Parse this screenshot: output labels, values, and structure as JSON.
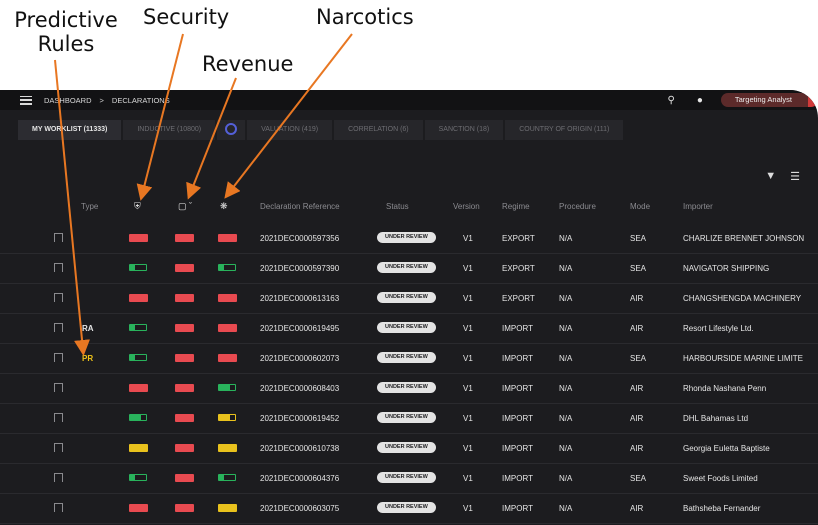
{
  "annotations": {
    "predictive_rules": "Predictive\nRules",
    "security": "Security",
    "revenue": "Revenue",
    "narcotics": "Narcotics"
  },
  "topbar": {
    "dashboard": "DASHBOARD",
    "separator": ">",
    "declarations": "DECLARATIONS",
    "role": "Targeting Analyst",
    "icons": [
      "search-icon",
      "bell-icon",
      "menu-icon"
    ]
  },
  "tabs": [
    {
      "label": "MY WORKLIST (11333)",
      "active": true
    },
    {
      "label": "INDUCTIVE (10800)",
      "active": false
    },
    {
      "label": "",
      "icon": "circle-icon",
      "active": false
    },
    {
      "label": "VALUATION (419)",
      "active": false
    },
    {
      "label": "CORRELATION (6)",
      "active": false
    },
    {
      "label": "SANCTION (18)",
      "active": false
    },
    {
      "label": "COUNTRY OF ORIGIN (111)",
      "active": false
    }
  ],
  "columns": {
    "type": "Type",
    "declaration_reference": "Declaration Reference",
    "status": "Status",
    "version": "Version",
    "regime": "Regime",
    "procedure": "Procedure",
    "mode": "Mode",
    "importer": "Importer"
  },
  "colors": {
    "red": "#e84a50",
    "yellow": "#e9c21d",
    "green": "#29b35c",
    "arrow": "#e87722"
  },
  "rows": [
    {
      "type": "",
      "security": "red",
      "revenue": "red",
      "narcotics": "red",
      "ref": "2021DEC0000597356",
      "status": "UNDER REVIEW",
      "version": "V1",
      "regime": "EXPORT",
      "procedure": "N/A",
      "mode": "SEA",
      "importer": "CHARLIZE BRENNET JOHNSON"
    },
    {
      "type": "",
      "security": "green",
      "revenue": "red",
      "narcotics": "green",
      "ref": "2021DEC0000597390",
      "status": "UNDER REVIEW",
      "version": "V1",
      "regime": "EXPORT",
      "procedure": "N/A",
      "mode": "SEA",
      "importer": "NAVIGATOR SHIPPING"
    },
    {
      "type": "",
      "security": "red",
      "revenue": "red",
      "narcotics": "red",
      "ref": "2021DEC0000613163",
      "status": "UNDER REVIEW",
      "version": "V1",
      "regime": "EXPORT",
      "procedure": "N/A",
      "mode": "AIR",
      "importer": "CHANGSHENGDA MACHINERY"
    },
    {
      "type": "RA",
      "security": "green",
      "revenue": "red",
      "narcotics": "red",
      "ref": "2021DEC0000619495",
      "status": "UNDER REVIEW",
      "version": "V1",
      "regime": "IMPORT",
      "procedure": "N/A",
      "mode": "AIR",
      "importer": "Resort Lifestyle Ltd."
    },
    {
      "type": "PR",
      "security": "green",
      "revenue": "red",
      "narcotics": "red",
      "ref": "2021DEC0000602073",
      "status": "UNDER REVIEW",
      "version": "V1",
      "regime": "IMPORT",
      "procedure": "N/A",
      "mode": "SEA",
      "importer": "HARBOURSIDE MARINE LIMITE"
    },
    {
      "type": "",
      "security": "red",
      "revenue": "red",
      "narcotics": "green-r",
      "ref": "2021DEC0000608403",
      "status": "UNDER REVIEW",
      "version": "V1",
      "regime": "IMPORT",
      "procedure": "N/A",
      "mode": "AIR",
      "importer": "Rhonda Nashana Penn"
    },
    {
      "type": "",
      "security": "green-r",
      "revenue": "red",
      "narcotics": "yellow-p",
      "ref": "2021DEC0000619452",
      "status": "UNDER REVIEW",
      "version": "V1",
      "regime": "IMPORT",
      "procedure": "N/A",
      "mode": "AIR",
      "importer": "DHL Bahamas Ltd"
    },
    {
      "type": "",
      "security": "yellow",
      "revenue": "red",
      "narcotics": "yellow",
      "ref": "2021DEC0000610738",
      "status": "UNDER REVIEW",
      "version": "V1",
      "regime": "IMPORT",
      "procedure": "N/A",
      "mode": "AIR",
      "importer": "Georgia Euletta Baptiste"
    },
    {
      "type": "",
      "security": "green",
      "revenue": "red",
      "narcotics": "green",
      "ref": "2021DEC0000604376",
      "status": "UNDER REVIEW",
      "version": "V1",
      "regime": "IMPORT",
      "procedure": "N/A",
      "mode": "SEA",
      "importer": "Sweet Foods Limited"
    },
    {
      "type": "",
      "security": "red",
      "revenue": "red",
      "narcotics": "yellow",
      "ref": "2021DEC0000603075",
      "status": "UNDER REVIEW",
      "version": "V1",
      "regime": "IMPORT",
      "procedure": "N/A",
      "mode": "AIR",
      "importer": "Bathsheba Fernander"
    }
  ]
}
